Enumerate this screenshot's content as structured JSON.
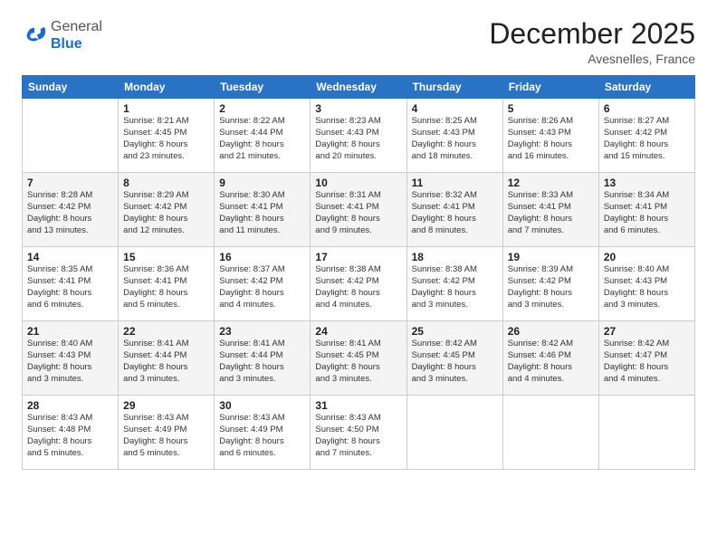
{
  "header": {
    "logo_line1": "General",
    "logo_line2": "Blue",
    "month_year": "December 2025",
    "location": "Avesnelles, France"
  },
  "days_of_week": [
    "Sunday",
    "Monday",
    "Tuesday",
    "Wednesday",
    "Thursday",
    "Friday",
    "Saturday"
  ],
  "weeks": [
    [
      {
        "day": "",
        "info": ""
      },
      {
        "day": "1",
        "info": "Sunrise: 8:21 AM\nSunset: 4:45 PM\nDaylight: 8 hours\nand 23 minutes."
      },
      {
        "day": "2",
        "info": "Sunrise: 8:22 AM\nSunset: 4:44 PM\nDaylight: 8 hours\nand 21 minutes."
      },
      {
        "day": "3",
        "info": "Sunrise: 8:23 AM\nSunset: 4:43 PM\nDaylight: 8 hours\nand 20 minutes."
      },
      {
        "day": "4",
        "info": "Sunrise: 8:25 AM\nSunset: 4:43 PM\nDaylight: 8 hours\nand 18 minutes."
      },
      {
        "day": "5",
        "info": "Sunrise: 8:26 AM\nSunset: 4:43 PM\nDaylight: 8 hours\nand 16 minutes."
      },
      {
        "day": "6",
        "info": "Sunrise: 8:27 AM\nSunset: 4:42 PM\nDaylight: 8 hours\nand 15 minutes."
      }
    ],
    [
      {
        "day": "7",
        "info": "Sunrise: 8:28 AM\nSunset: 4:42 PM\nDaylight: 8 hours\nand 13 minutes."
      },
      {
        "day": "8",
        "info": "Sunrise: 8:29 AM\nSunset: 4:42 PM\nDaylight: 8 hours\nand 12 minutes."
      },
      {
        "day": "9",
        "info": "Sunrise: 8:30 AM\nSunset: 4:41 PM\nDaylight: 8 hours\nand 11 minutes."
      },
      {
        "day": "10",
        "info": "Sunrise: 8:31 AM\nSunset: 4:41 PM\nDaylight: 8 hours\nand 9 minutes."
      },
      {
        "day": "11",
        "info": "Sunrise: 8:32 AM\nSunset: 4:41 PM\nDaylight: 8 hours\nand 8 minutes."
      },
      {
        "day": "12",
        "info": "Sunrise: 8:33 AM\nSunset: 4:41 PM\nDaylight: 8 hours\nand 7 minutes."
      },
      {
        "day": "13",
        "info": "Sunrise: 8:34 AM\nSunset: 4:41 PM\nDaylight: 8 hours\nand 6 minutes."
      }
    ],
    [
      {
        "day": "14",
        "info": "Sunrise: 8:35 AM\nSunset: 4:41 PM\nDaylight: 8 hours\nand 6 minutes."
      },
      {
        "day": "15",
        "info": "Sunrise: 8:36 AM\nSunset: 4:41 PM\nDaylight: 8 hours\nand 5 minutes."
      },
      {
        "day": "16",
        "info": "Sunrise: 8:37 AM\nSunset: 4:42 PM\nDaylight: 8 hours\nand 4 minutes."
      },
      {
        "day": "17",
        "info": "Sunrise: 8:38 AM\nSunset: 4:42 PM\nDaylight: 8 hours\nand 4 minutes."
      },
      {
        "day": "18",
        "info": "Sunrise: 8:38 AM\nSunset: 4:42 PM\nDaylight: 8 hours\nand 3 minutes."
      },
      {
        "day": "19",
        "info": "Sunrise: 8:39 AM\nSunset: 4:42 PM\nDaylight: 8 hours\nand 3 minutes."
      },
      {
        "day": "20",
        "info": "Sunrise: 8:40 AM\nSunset: 4:43 PM\nDaylight: 8 hours\nand 3 minutes."
      }
    ],
    [
      {
        "day": "21",
        "info": "Sunrise: 8:40 AM\nSunset: 4:43 PM\nDaylight: 8 hours\nand 3 minutes."
      },
      {
        "day": "22",
        "info": "Sunrise: 8:41 AM\nSunset: 4:44 PM\nDaylight: 8 hours\nand 3 minutes."
      },
      {
        "day": "23",
        "info": "Sunrise: 8:41 AM\nSunset: 4:44 PM\nDaylight: 8 hours\nand 3 minutes."
      },
      {
        "day": "24",
        "info": "Sunrise: 8:41 AM\nSunset: 4:45 PM\nDaylight: 8 hours\nand 3 minutes."
      },
      {
        "day": "25",
        "info": "Sunrise: 8:42 AM\nSunset: 4:45 PM\nDaylight: 8 hours\nand 3 minutes."
      },
      {
        "day": "26",
        "info": "Sunrise: 8:42 AM\nSunset: 4:46 PM\nDaylight: 8 hours\nand 4 minutes."
      },
      {
        "day": "27",
        "info": "Sunrise: 8:42 AM\nSunset: 4:47 PM\nDaylight: 8 hours\nand 4 minutes."
      }
    ],
    [
      {
        "day": "28",
        "info": "Sunrise: 8:43 AM\nSunset: 4:48 PM\nDaylight: 8 hours\nand 5 minutes."
      },
      {
        "day": "29",
        "info": "Sunrise: 8:43 AM\nSunset: 4:49 PM\nDaylight: 8 hours\nand 5 minutes."
      },
      {
        "day": "30",
        "info": "Sunrise: 8:43 AM\nSunset: 4:49 PM\nDaylight: 8 hours\nand 6 minutes."
      },
      {
        "day": "31",
        "info": "Sunrise: 8:43 AM\nSunset: 4:50 PM\nDaylight: 8 hours\nand 7 minutes."
      },
      {
        "day": "",
        "info": ""
      },
      {
        "day": "",
        "info": ""
      },
      {
        "day": "",
        "info": ""
      }
    ]
  ]
}
